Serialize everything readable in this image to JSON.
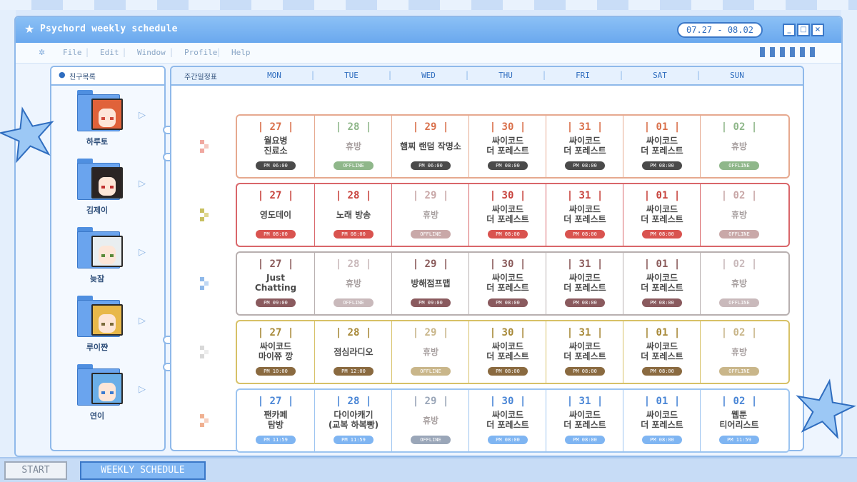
{
  "window": {
    "title": "Psychord weekly schedule",
    "date_range": "07.27 - 08.02",
    "buttons": {
      "minimize": "_",
      "maximize": "□",
      "close": "×"
    }
  },
  "menu": {
    "items": [
      "File",
      "Edit",
      "Window",
      "Profile",
      "Help"
    ]
  },
  "friends": {
    "title": "친구목록",
    "members": [
      {
        "name": "하루토",
        "hair": "#e0623a",
        "eye": "#d04a3a"
      },
      {
        "name": "김제이",
        "hair": "#2b2424",
        "eye": "#c03030"
      },
      {
        "name": "늦잠",
        "hair": "#e9eef0",
        "eye": "#5a8a3a"
      },
      {
        "name": "루이쨘",
        "hair": "#e8b84a",
        "eye": "#7a6a3a"
      },
      {
        "name": "연이",
        "hair": "#6aaee8",
        "eye": "#3a7ad0"
      }
    ]
  },
  "schedule": {
    "corner_label": "주간일정표",
    "days": [
      "MON",
      "TUE",
      "WED",
      "THU",
      "FRI",
      "SAT",
      "SUN"
    ],
    "rows": [
      {
        "border": "#e6a98f",
        "accent": "#d9704b",
        "badge": "#4a4a4a",
        "offline": "#8fb78a",
        "dim": false,
        "cells": [
          {
            "date": "| 27 |",
            "event": "월요병\n진료소",
            "time": "PM 06:00"
          },
          {
            "date": "| 28 |",
            "event": "휴방",
            "time": "OFFLINE",
            "off": true
          },
          {
            "date": "| 29 |",
            "event": "햄찌 랜덤 작명소",
            "time": "PM 06:00"
          },
          {
            "date": "| 30 |",
            "event": "싸이코드\n더 포레스트",
            "time": "PM 08:00"
          },
          {
            "date": "| 31 |",
            "event": "싸이코드\n더 포레스트",
            "time": "PM 08:00"
          },
          {
            "date": "| 01 |",
            "event": "싸이코드\n더 포레스트",
            "time": "PM 08:00"
          },
          {
            "date": "| 02 |",
            "event": "휴방",
            "time": "OFFLINE",
            "off": true
          }
        ]
      },
      {
        "border": "#d9666a",
        "accent": "#c8453f",
        "badge": "#d9534f",
        "offline": "#c9a8a8",
        "cells": [
          {
            "date": "| 27 |",
            "event": "영도데이",
            "time": "PM 08:00"
          },
          {
            "date": "| 28 |",
            "event": "노래 방송",
            "time": "PM 08:00"
          },
          {
            "date": "| 29 |",
            "event": "휴방",
            "time": "OFFLINE",
            "off": true
          },
          {
            "date": "| 30 |",
            "event": "싸이코드\n더 포레스트",
            "time": "PM 08:00"
          },
          {
            "date": "| 31 |",
            "event": "싸이코드\n더 포레스트",
            "time": "PM 08:00"
          },
          {
            "date": "| 01 |",
            "event": "싸이코드\n더 포레스트",
            "time": "PM 08:00"
          },
          {
            "date": "| 02 |",
            "event": "휴방",
            "time": "OFFLINE",
            "off": true
          }
        ]
      },
      {
        "border": "#b8b0b0",
        "accent": "#8a5a5a",
        "badge": "#8a5a5e",
        "offline": "#c9b9bb",
        "cells": [
          {
            "date": "| 27 |",
            "event": "Just\nChatting",
            "time": "PM 09:00"
          },
          {
            "date": "| 28 |",
            "event": "휴방",
            "time": "OFFLINE",
            "off": true
          },
          {
            "date": "| 29 |",
            "event": "방해점프맵",
            "time": "PM 09:00"
          },
          {
            "date": "| 30 |",
            "event": "싸이코드\n더 포레스트",
            "time": "PM 08:00"
          },
          {
            "date": "| 31 |",
            "event": "싸이코드\n더 포레스트",
            "time": "PM 08:00"
          },
          {
            "date": "| 01 |",
            "event": "싸이코드\n더 포레스트",
            "time": "PM 08:00"
          },
          {
            "date": "| 02 |",
            "event": "휴방",
            "time": "OFFLINE",
            "off": true
          }
        ]
      },
      {
        "border": "#d7c167",
        "accent": "#a88a3a",
        "badge": "#8a6a40",
        "offline": "#c9b68a",
        "cells": [
          {
            "date": "| 27 |",
            "event": "싸이코드\n마이쮸 깡",
            "time": "PM 10:00"
          },
          {
            "date": "| 28 |",
            "event": "점심라디오",
            "time": "PM 12:00"
          },
          {
            "date": "| 29 |",
            "event": "휴방",
            "time": "OFFLINE",
            "off": true
          },
          {
            "date": "| 30 |",
            "event": "싸이코드\n더 포레스트",
            "time": "PM 08:00"
          },
          {
            "date": "| 31 |",
            "event": "싸이코드\n더 포레스트",
            "time": "PM 08:00"
          },
          {
            "date": "| 01 |",
            "event": "싸이코드\n더 포레스트",
            "time": "PM 08:00"
          },
          {
            "date": "| 02 |",
            "event": "휴방",
            "time": "OFFLINE",
            "off": true
          }
        ]
      },
      {
        "border": "#9cc4f0",
        "accent": "#4a86d6",
        "badge": "#7fb5f2",
        "offline": "#9aa6b8",
        "cells": [
          {
            "date": "| 27 |",
            "event": "팬카페\n탐방",
            "time": "PM 11:59"
          },
          {
            "date": "| 28 |",
            "event": "다이아캐기\n(교복 하복빵)",
            "time": "PM 11:59"
          },
          {
            "date": "| 29 |",
            "event": "휴방",
            "time": "OFFLINE",
            "off": true
          },
          {
            "date": "| 30 |",
            "event": "싸이코드\n더 포레스트",
            "time": "PM 08:00"
          },
          {
            "date": "| 31 |",
            "event": "싸이코드\n더 포레스트",
            "time": "PM 08:00"
          },
          {
            "date": "| 01 |",
            "event": "싸이코드\n더 포레스트",
            "time": "PM 08:00"
          },
          {
            "date": "| 02 |",
            "event": "웹툰\n티어리스트",
            "time": "PM 11:59"
          }
        ]
      }
    ]
  },
  "taskbar": {
    "start_label": "START",
    "active_task": "WEEKLY SCHEDULE"
  },
  "colors": {
    "accent": "#3b78c8",
    "titlebar": "#6aa8ee",
    "panel_border": "#8fb9ea"
  }
}
